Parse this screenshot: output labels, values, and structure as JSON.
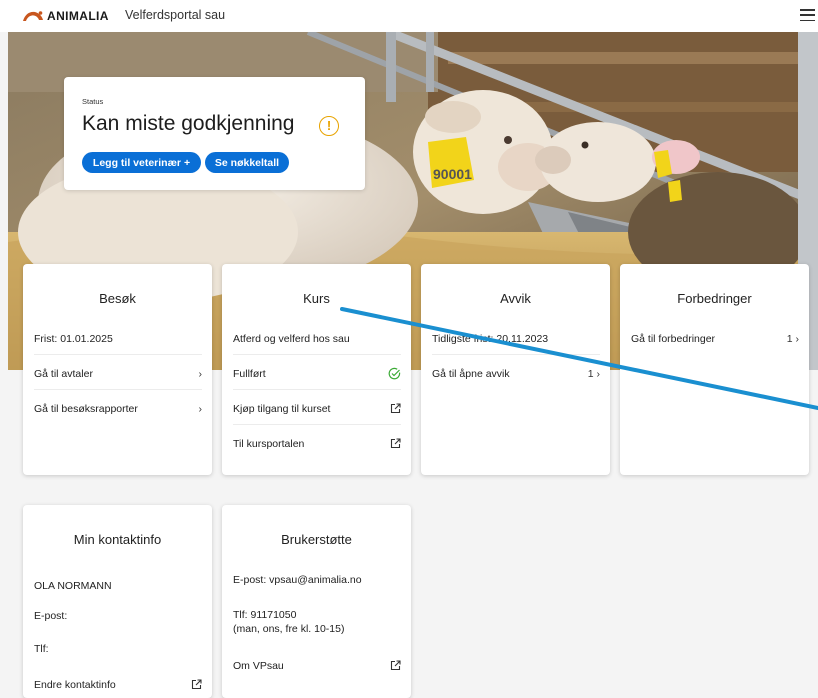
{
  "header": {
    "brand": "ANIMALIA",
    "portal_title": "Velferdsportal sau"
  },
  "hero": {
    "ear_tag": "90001"
  },
  "status": {
    "label": "Status",
    "text": "Kan miste godkjenning",
    "warning_symbol": "!",
    "btn_vet": "Legg til veterinær +",
    "btn_key": "Se nøkkeltall"
  },
  "cards": {
    "besok": {
      "title": "Besøk",
      "deadline": "Frist:  01.01.2025",
      "avtaler": "Gå til avtaler",
      "rapporter": "Gå til besøksrapporter"
    },
    "kurs": {
      "title": "Kurs",
      "course": "Atferd og velferd hos sau",
      "completed": "Fullført",
      "buy": "Kjøp tilgang til kurset",
      "portal": "Til kursportalen"
    },
    "avvik": {
      "title": "Avvik",
      "earliest": "Tidligste frist: 20.11.2023",
      "open": "Gå til åpne avvik",
      "open_count": "1 ›"
    },
    "forbedringer": {
      "title": "Forbedringer",
      "goto": "Gå til forbedringer",
      "count": "1 ›"
    },
    "kontakt": {
      "title": "Min kontaktinfo",
      "name": "OLA NORMANN",
      "email": "E-post:",
      "phone": "Tlf:",
      "edit": "Endre kontaktinfo"
    },
    "support": {
      "title": "Brukerstøtte",
      "email": "E-post: vpsau@animalia.no",
      "phone": "Tlf: 91171050",
      "hours": "(man, ons, fre kl. 10-15)",
      "about": "Om VPsau"
    }
  },
  "colors": {
    "primary": "#0a6fd6",
    "warning": "#e8a300",
    "success": "#3aaa35",
    "annotation_arrow": "#1a8fd0"
  }
}
